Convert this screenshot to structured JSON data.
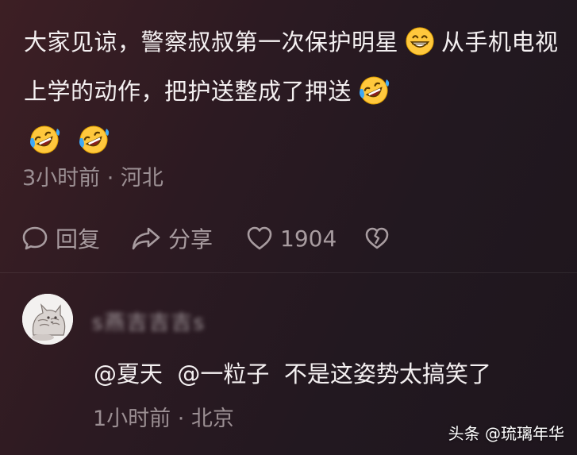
{
  "post": {
    "text_part1": "大家见谅，警察叔叔第一次保护明星",
    "text_part2": "从手机电视上学的动作，把护送整成了押送",
    "emojis": [
      "grin-emoji",
      "rofl-emoji",
      "rofl-emoji",
      "rofl-emoji"
    ],
    "meta": "3小时前 · 河北"
  },
  "actions": {
    "reply_label": "回复",
    "share_label": "分享",
    "like_count": "1904"
  },
  "comment": {
    "username": "s燕吉吉吉s",
    "text": "@夏天  @一粒子  不是这姿势太搞笑了",
    "meta": "1小时前 · 北京"
  },
  "watermark": "头条 @琉璃年华",
  "colors": {
    "background": "#2a1a21",
    "text": "#f4f0f1",
    "muted": "#9b8f93",
    "emoji_yellow": "#ffc83d",
    "emoji_tears": "#3fa9f5"
  }
}
